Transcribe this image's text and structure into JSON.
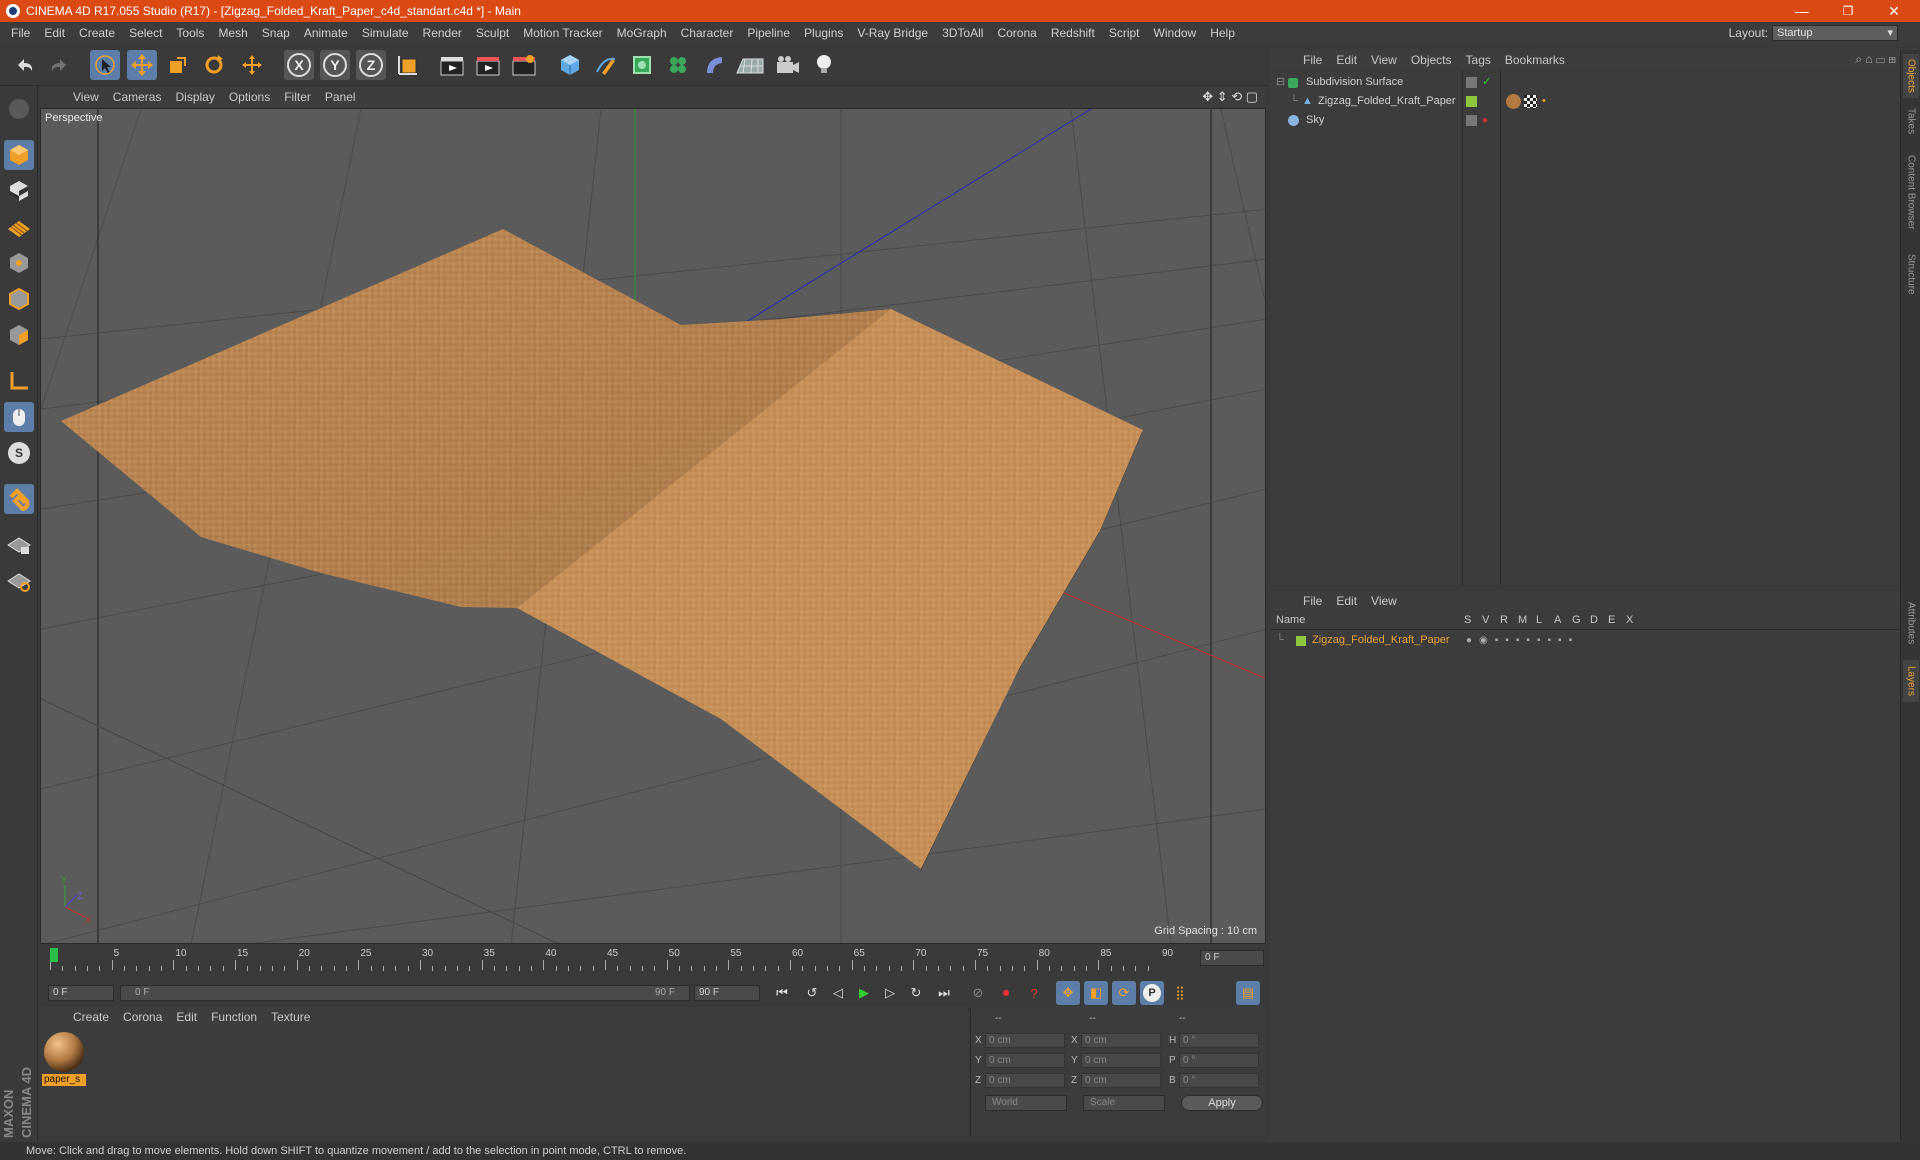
{
  "window": {
    "title": "CINEMA 4D R17.055 Studio (R17) - [Zigzag_Folded_Kraft_Paper_c4d_standart.c4d *] - Main",
    "minimize": "—",
    "maximize": "❐",
    "close": "✕"
  },
  "menu": [
    "File",
    "Edit",
    "Create",
    "Select",
    "Tools",
    "Mesh",
    "Snap",
    "Animate",
    "Simulate",
    "Render",
    "Sculpt",
    "Motion Tracker",
    "MoGraph",
    "Character",
    "Pipeline",
    "Plugins",
    "V-Ray Bridge",
    "3DToAll",
    "Corona",
    "Redshift",
    "Script",
    "Window",
    "Help"
  ],
  "layout": {
    "label": "Layout:",
    "value": "Startup"
  },
  "toolbar": {
    "x_label": "X",
    "y_label": "Y",
    "z_label": "Z"
  },
  "left_tools": {
    "snap_label": "S"
  },
  "viewport": {
    "menu": [
      "View",
      "Cameras",
      "Display",
      "Options",
      "Filter",
      "Panel"
    ],
    "label": "Perspective",
    "grid_spacing": "Grid Spacing : 10 cm"
  },
  "timeline": {
    "ticks": [
      "0",
      "5",
      "10",
      "15",
      "20",
      "25",
      "30",
      "35",
      "40",
      "45",
      "50",
      "55",
      "60",
      "65",
      "70",
      "75",
      "80",
      "85",
      "90"
    ],
    "current_frame": "0 F"
  },
  "anim": {
    "start": "0 F",
    "range_start": "0 F",
    "range_end": "90 F",
    "end": "90 F",
    "record_label": "P"
  },
  "material_manager": {
    "menu": [
      "Create",
      "Corona",
      "Edit",
      "Function",
      "Texture"
    ],
    "materials": [
      {
        "name": "paper_s"
      }
    ]
  },
  "coordinates": {
    "headers": [
      "--",
      "--",
      "--"
    ],
    "rows": [
      {
        "l1": "X",
        "v1": "0 cm",
        "l2": "X",
        "v2": "0 cm",
        "l3": "H",
        "v3": "0 °"
      },
      {
        "l1": "Y",
        "v1": "0 cm",
        "l2": "Y",
        "v2": "0 cm",
        "l3": "P",
        "v3": "0 °"
      },
      {
        "l1": "Z",
        "v1": "0 cm",
        "l2": "Z",
        "v2": "0 cm",
        "l3": "B",
        "v3": "0 °"
      }
    ],
    "mode": "World",
    "transform": "Scale",
    "apply": "Apply"
  },
  "object_manager": {
    "menu": [
      "File",
      "Edit",
      "View",
      "Objects",
      "Tags",
      "Bookmarks"
    ],
    "objects": [
      {
        "name": "Subdivision Surface"
      },
      {
        "name": "Zigzag_Folded_Kraft_Paper"
      },
      {
        "name": "Sky"
      }
    ]
  },
  "layer_manager": {
    "menu": [
      "File",
      "Edit",
      "View"
    ],
    "columns": [
      "Name",
      "S",
      "V",
      "R",
      "M",
      "L",
      "A",
      "G",
      "D",
      "E",
      "X"
    ],
    "layers": [
      {
        "name": "Zigzag_Folded_Kraft_Paper",
        "color": "#8fc63f"
      }
    ]
  },
  "right_tabs": [
    "Objects",
    "Takes",
    "Content Browser",
    "Structure",
    "Attributes",
    "Layers"
  ],
  "status": "Move: Click and drag to move elements. Hold down SHIFT to quantize movement / add to the selection in point mode, CTRL to remove.",
  "brand": "MAXON CINEMA 4D",
  "colors": {
    "accent": "#db4a14",
    "selection": "#5c7ea8",
    "layer_name": "#e8a23a"
  }
}
